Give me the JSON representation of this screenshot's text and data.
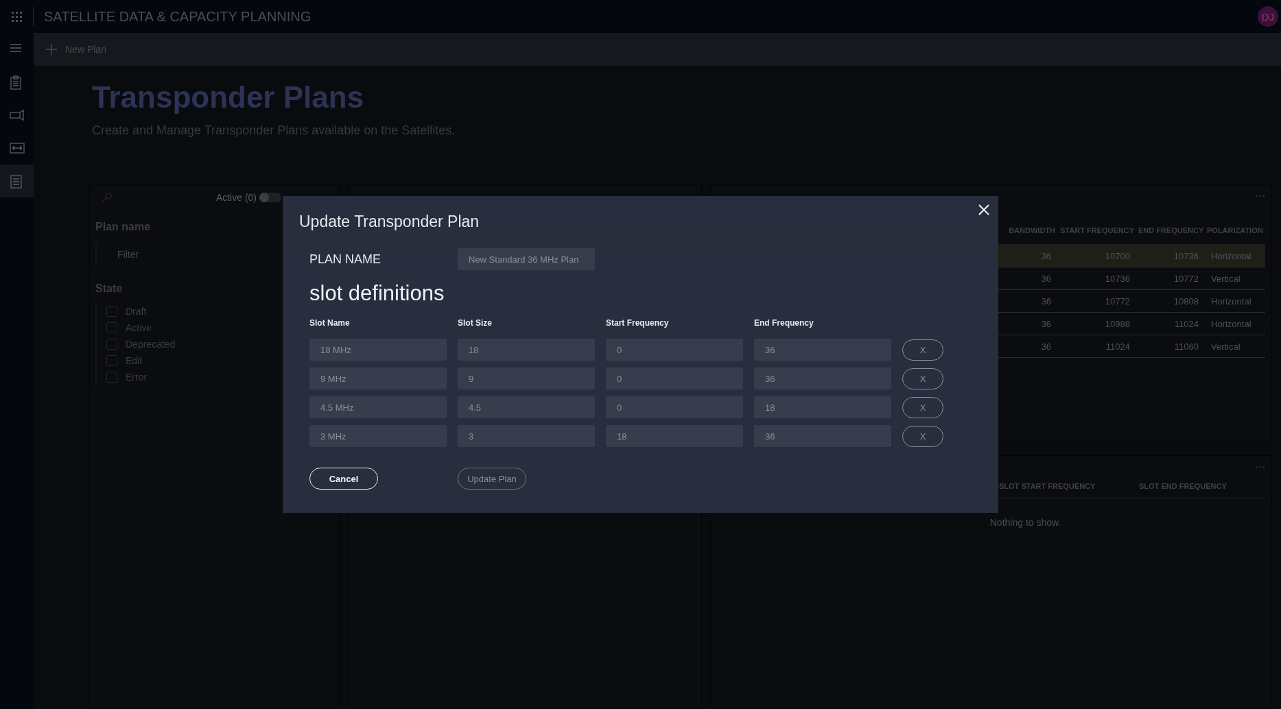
{
  "app": {
    "title": "SATELLITE DATA & CAPACITY PLANNING",
    "avatar": "DJ"
  },
  "sidebar": {
    "items": [
      {
        "kind": "menu",
        "selected": false
      },
      {
        "kind": "clipboard",
        "selected": false
      },
      {
        "kind": "flashlight",
        "selected": false
      },
      {
        "kind": "resize",
        "selected": false
      },
      {
        "kind": "document",
        "selected": true
      }
    ]
  },
  "command_bar": {
    "buttons": [
      {
        "label": "New Plan"
      }
    ]
  },
  "page": {
    "title": "Transponder Plans",
    "subtitle": "Create and Manage Transponder Plans available on the Satellites."
  },
  "filters": {
    "active_toggle": {
      "label": "Active (0)",
      "on": false
    },
    "plan_name": {
      "label": "Plan name",
      "placeholder": "Filter"
    },
    "state": {
      "label": "State",
      "options": [
        {
          "label": "Draft",
          "checked": false
        },
        {
          "label": "Active",
          "checked": false
        },
        {
          "label": "Deprecated",
          "checked": false
        },
        {
          "label": "Edit",
          "checked": false
        },
        {
          "label": "Error",
          "checked": false
        }
      ]
    }
  },
  "transponders_table": {
    "columns": [
      "BANDWIDTH",
      "START FREQUENCY",
      "END FREQUENCY",
      "POLARIZATION"
    ],
    "rows": [
      {
        "cells": [
          "36",
          "10700",
          "10736",
          "Horizontal"
        ],
        "selected": true
      },
      {
        "cells": [
          "36",
          "10736",
          "10772",
          "Vertical"
        ],
        "selected": false
      },
      {
        "cells": [
          "36",
          "10772",
          "10808",
          "Horizontal"
        ],
        "selected": false
      },
      {
        "cells": [
          "36",
          "10988",
          "11024",
          "Horizontal"
        ],
        "selected": false
      },
      {
        "cells": [
          "36",
          "11024",
          "11060",
          "Vertical"
        ],
        "selected": false
      }
    ]
  },
  "slots_table": {
    "columns": [
      "SLOT START FREQUENCY",
      "SLOT END FREQUENCY"
    ],
    "empty_message": "Nothing to show."
  },
  "dialog": {
    "title": "Update Transponder Plan",
    "plan_name": {
      "label": "PLAN NAME",
      "value": "New Standard 36 MHz Plan"
    },
    "section_title": "slot definitions",
    "columns": [
      "Slot Name",
      "Slot Size",
      "Start Frequency",
      "End Frequency"
    ],
    "slots": [
      {
        "name": "18 MHz",
        "size": "18",
        "start": "0",
        "end": "36",
        "remove": "X"
      },
      {
        "name": "9 MHz",
        "size": "9",
        "start": "0",
        "end": "36",
        "remove": "X"
      },
      {
        "name": "4.5 MHz",
        "size": "4.5",
        "start": "0",
        "end": "18",
        "remove": "X"
      },
      {
        "name": "3 MHz",
        "size": "3",
        "start": "18",
        "end": "36",
        "remove": "X"
      }
    ],
    "buttons": [
      {
        "label": "Cancel",
        "disabled": false
      },
      {
        "label": "Update Plan",
        "disabled": true
      }
    ]
  }
}
